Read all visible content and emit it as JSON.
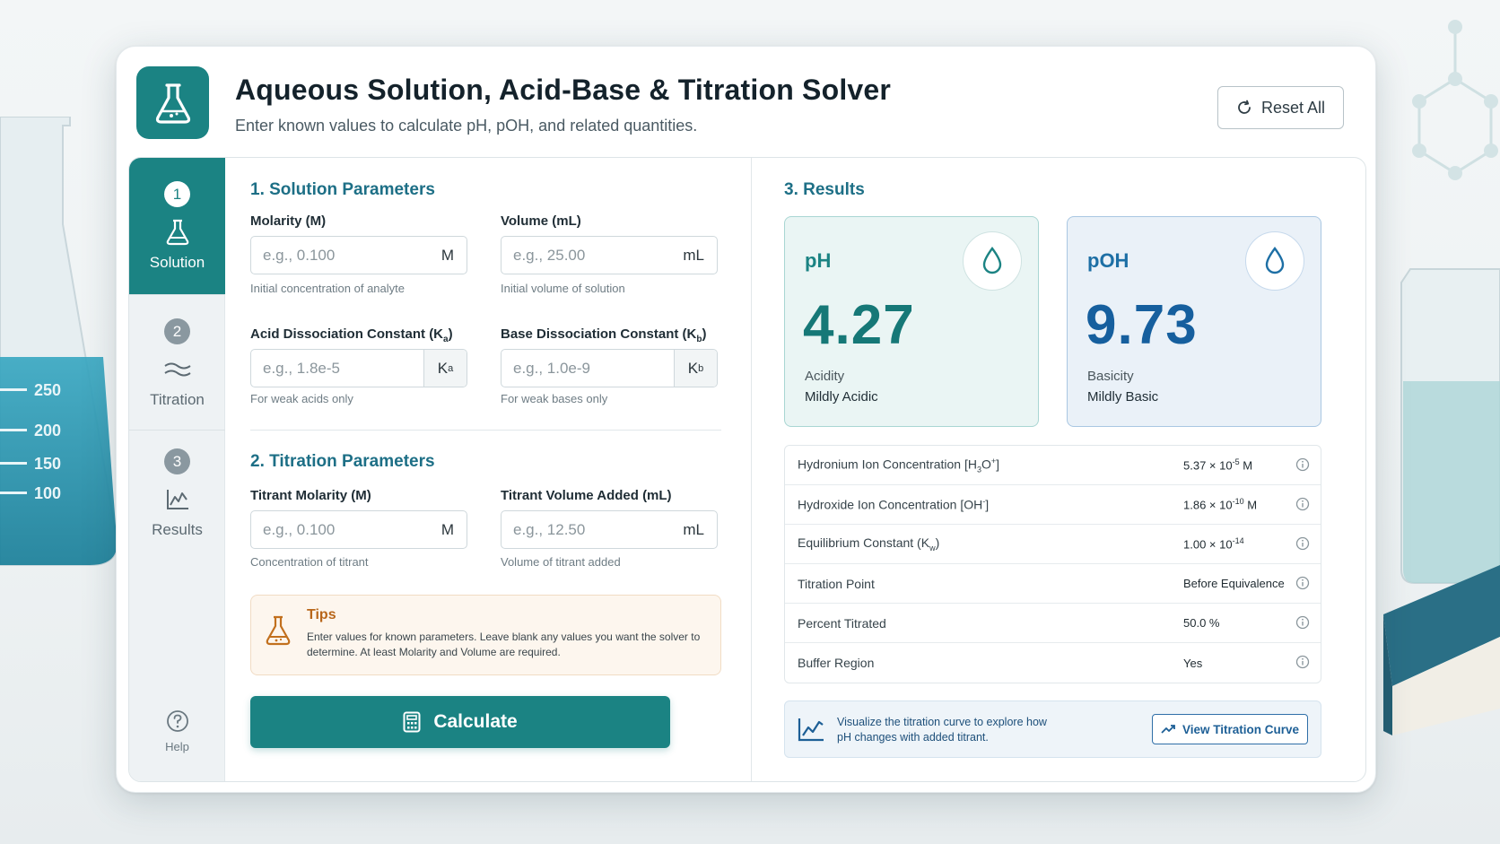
{
  "header": {
    "title": "Aqueous Solution, Acid-Base & Titration Solver",
    "subtitle": "Enter known values to calculate pH, pOH, and related quantities.",
    "reset_label": "Reset All"
  },
  "sidebar": {
    "steps": [
      {
        "num": "1",
        "label": "Solution",
        "icon": "flask-icon",
        "active": true
      },
      {
        "num": "2",
        "label": "Titration",
        "icon": "waves-icon",
        "active": false
      },
      {
        "num": "3",
        "label": "Results",
        "icon": "chart-icon",
        "active": false
      }
    ],
    "help_label": "Help"
  },
  "solution": {
    "title": "1. Solution Parameters",
    "molarity": {
      "label": "Molarity (M)",
      "placeholder": "e.g., 0.100",
      "unit": "M",
      "helper": "Initial concentration of analyte"
    },
    "volume": {
      "label": "Volume (mL)",
      "placeholder": "e.g., 25.00",
      "unit": "mL",
      "helper": "Initial volume of solution"
    },
    "ka": {
      "label": "Acid Dissociation Constant (K",
      "sub": "a",
      "label_end": ")",
      "placeholder": "e.g., 1.8e-5",
      "unit": "K",
      "unit_sub": "a",
      "helper": "For weak acids only"
    },
    "kb": {
      "label": "Base Dissociation Constant (K",
      "sub": "b",
      "label_end": ")",
      "placeholder": "e.g., 1.0e-9",
      "unit": "K",
      "unit_sub": "b",
      "helper": "For weak bases only"
    }
  },
  "titration": {
    "title": "2. Titration Parameters",
    "titrant_molarity": {
      "label": "Titrant Molarity (M)",
      "placeholder": "e.g., 0.100",
      "unit": "M",
      "helper": "Concentration of titrant"
    },
    "titrant_volume": {
      "label": "Titrant Volume Added (mL)",
      "placeholder": "e.g., 12.50",
      "unit": "mL",
      "helper": "Volume of titrant added"
    }
  },
  "tips": {
    "title": "Tips",
    "text": "Enter values for known parameters. Leave blank any values you want the solver to determine. At least Molarity and Volume are required."
  },
  "calculate_label": "Calculate",
  "results": {
    "title": "3. Results",
    "ph": {
      "label": "pH",
      "value": "4.27",
      "sub": "Acidity",
      "desc": "Mildly Acidic"
    },
    "poh": {
      "label": "pOH",
      "value": "9.73",
      "sub": "Basicity",
      "desc": "Mildly Basic"
    },
    "rows": [
      {
        "label_pre": "Hydronium Ion Concentration [H",
        "label_sub": "3",
        "label_mid": "O",
        "label_sup": "+",
        "label_post": "]",
        "value_pre": "5.37 × 10",
        "value_sup": "-5",
        "value_post": " M"
      },
      {
        "label_pre": "Hydroxide Ion Concentration [OH",
        "label_sub": "",
        "label_mid": "",
        "label_sup": "-",
        "label_post": "]",
        "value_pre": "1.86 × 10",
        "value_sup": "-10",
        "value_post": " M"
      },
      {
        "label_pre": "Equilibrium Constant (K",
        "label_sub": "w",
        "label_mid": "",
        "label_sup": "",
        "label_post": ")",
        "value_pre": "1.00 × 10",
        "value_sup": "-14",
        "value_post": ""
      },
      {
        "label_pre": "Titration Point",
        "label_sub": "",
        "label_mid": "",
        "label_sup": "",
        "label_post": "",
        "value_pre": "Before Equivalence",
        "value_sup": "",
        "value_post": ""
      },
      {
        "label_pre": "Percent Titrated",
        "label_sub": "",
        "label_mid": "",
        "label_sup": "",
        "label_post": "",
        "value_pre": "50.0 %",
        "value_sup": "",
        "value_post": ""
      },
      {
        "label_pre": "Buffer Region",
        "label_sub": "",
        "label_mid": "",
        "label_sup": "",
        "label_post": "",
        "value_pre": "Yes",
        "value_sup": "",
        "value_post": ""
      }
    ],
    "viz_text": "Visualize the titration curve to explore how pH changes with added titrant.",
    "viz_button": "View Titration Curve"
  },
  "background": {
    "flask_marks": [
      "250",
      "200",
      "150",
      "100"
    ]
  },
  "colors": {
    "accent": "#1b8383",
    "blue": "#1d6fa5",
    "tips": "#b8661a"
  }
}
